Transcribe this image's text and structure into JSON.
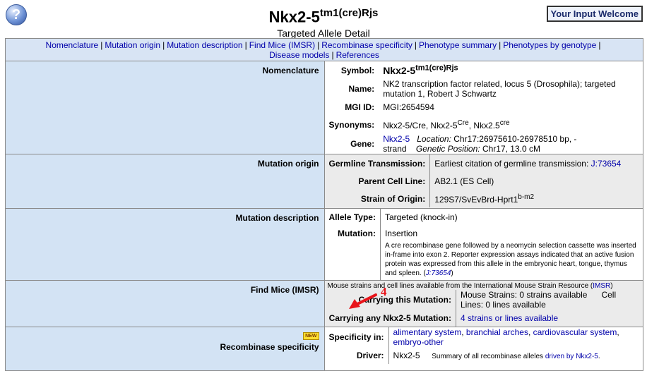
{
  "header": {
    "help_icon": "question-mark-icon",
    "help_glyph": "?",
    "title_main": "Nkx2-5",
    "title_sup": "tm1(cre)Rjs",
    "subtitle": "Targeted Allele Detail",
    "welcome_button": "Your Input Welcome"
  },
  "nav": {
    "links": [
      "Nomenclature",
      "Mutation origin",
      "Mutation description",
      "Find Mice (IMSR)",
      "Recombinase specificity",
      "Phenotype summary",
      "Phenotypes by genotype",
      "Disease models",
      "References"
    ]
  },
  "nomenclature": {
    "label": "Nomenclature",
    "symbol_label": "Symbol:",
    "symbol_main": "Nkx2-5",
    "symbol_sup": "tm1(cre)Rjs",
    "name_label": "Name:",
    "name_value": "NK2 transcription factor related, locus 5 (Drosophila); targeted mutation 1, Robert J Schwartz",
    "mgi_label": "MGI ID:",
    "mgi_value": "MGI:2654594",
    "synonyms_label": "Synonyms:",
    "syn1": "Nkx2-5/Cre, ",
    "syn2_main": "Nkx2-5",
    "syn2_sup": "Cre",
    "syn_sep": ", ",
    "syn3_main": "Nkx2.5",
    "syn3_sup": "cre",
    "gene_label": "Gene:",
    "gene_link": "Nkx2-5",
    "location_label": "Location:",
    "location_value": "Chr17:26975610-26978510 bp, - strand",
    "genetic_label": "Genetic Position:",
    "genetic_value": "Chr17, 13.0 cM"
  },
  "mutation_origin": {
    "label": "Mutation origin",
    "germline_label": "Germline Transmission:",
    "germline_text": "Earliest citation of germline transmission: ",
    "germline_link": "J:73654",
    "parent_label": "Parent Cell Line:",
    "parent_value": "AB2.1 (ES Cell)",
    "strain_label": "Strain of Origin:",
    "strain_main": "129S7/SvEvBrd-Hprt1",
    "strain_sup": "b-m2"
  },
  "mutation_description": {
    "label": "Mutation description",
    "allele_type_label": "Allele Type:",
    "allele_type_value": "Targeted (knock-in)",
    "mutation_label": "Mutation:",
    "mutation_value": "Insertion",
    "note": "A cre recombinase gene followed by a neomycin selection cassette was inserted in-frame into exon 2. Reporter expression assays indicated that an active fusion protein was expressed from this allele in the embryonic heart, tongue, thymus and spleen. (",
    "note_link": "J:73654",
    "note_end": ")"
  },
  "find_mice": {
    "label": "Find Mice (IMSR)",
    "intro": "Mouse strains and cell lines available from the International Mouse Strain Resource (",
    "intro_link": "IMSR",
    "intro_end": ")",
    "carrying_this_label": "Carrying this Mutation:",
    "mouse_strains": "Mouse Strains: 0 strains available",
    "cell_lines": "Cell Lines: 0 lines available",
    "carrying_any_label": "Carrying any Nkx2-5 Mutation:",
    "carrying_any_link": "4 strains or lines available"
  },
  "recombinase": {
    "new_badge": "NEW",
    "label": "Recombinase specificity",
    "specificity_label": "Specificity in:",
    "tissues": [
      "alimentary system",
      "branchial arches",
      "cardiovascular system",
      "embryo-other"
    ],
    "driver_label": "Driver:",
    "driver_value": "Nkx2-5",
    "summary_text": "Summary of all recombinase alleles ",
    "summary_link": "driven by Nkx2-5",
    "summary_end": "."
  },
  "annotation": {
    "marker_number": "4",
    "arrow_color": "#e8141a"
  },
  "colors": {
    "link": "#0000aa",
    "label_bg": "#d3e3f4",
    "nav_bg": "#d8e4f4",
    "gray_bg": "#ebebeb"
  }
}
